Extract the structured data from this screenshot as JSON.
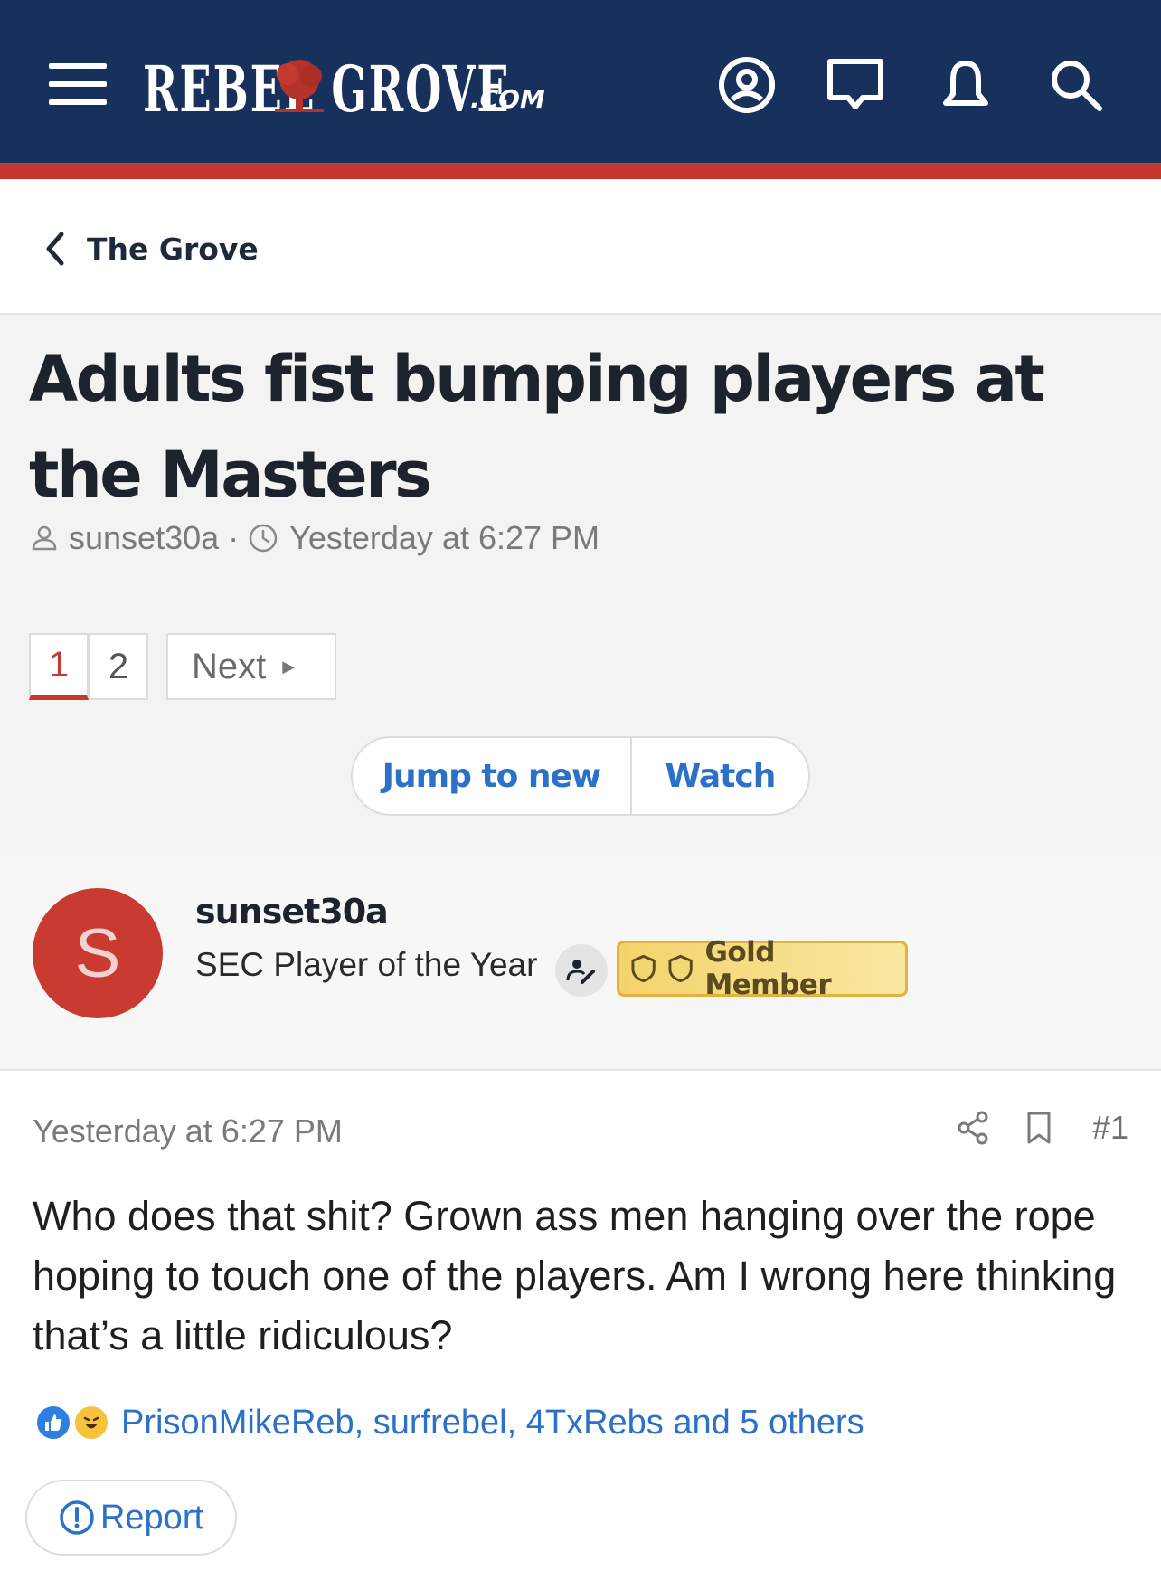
{
  "header": {
    "logo_text": "REBEL GROVE",
    "logo_suffix": ".COM",
    "icons": [
      "menu-icon",
      "account-icon",
      "messages-icon",
      "alerts-icon",
      "search-icon"
    ],
    "colors": {
      "bar": "#17315c",
      "stripe": "#c4382e"
    }
  },
  "breadcrumb": {
    "label": "The Grove"
  },
  "thread": {
    "title": "Adults fist bumping players at the Masters",
    "author": "sunset30a",
    "separator": "·",
    "time": "Yesterday at 6:27 PM"
  },
  "pagination": {
    "pages": [
      "1",
      "2"
    ],
    "current": "1",
    "next_label": "Next"
  },
  "actions": {
    "jump_label": "Jump to new",
    "watch_label": "Watch"
  },
  "author_block": {
    "avatar_letter": "S",
    "username": "sunset30a",
    "user_title": "SEC Player of the Year",
    "badge": "Gold Member"
  },
  "post": {
    "date": "Yesterday at 6:27 PM",
    "number": "#1",
    "body": "Who does that shit? Grown ass men hanging over the rope hoping to touch one of the players. Am I wrong here thinking that’s a little ridiculous?",
    "reactions": "PrisonMikeReb, surfrebel, 4TxRebs and 5 others",
    "report_label": "Report"
  },
  "colors": {
    "accent_link": "#2b70c9",
    "active_page": "#c4382e",
    "gold_badge": "#f3d36b"
  }
}
